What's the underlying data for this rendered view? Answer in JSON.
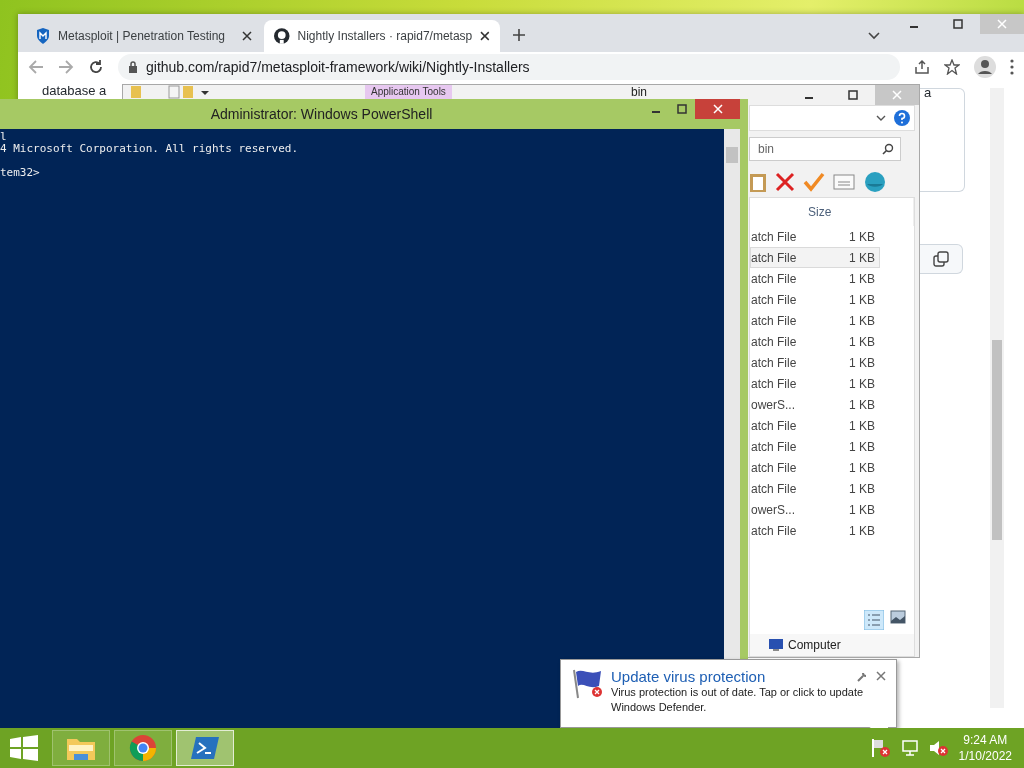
{
  "browser": {
    "tabs": [
      {
        "title": "Metasploit | Penetration Testing",
        "selected": false
      },
      {
        "title": "Nightly Installers · rapid7/metasp",
        "selected": true
      }
    ],
    "url": "github.com/rapid7/metasploit-framework/wiki/Nightly-Installers",
    "page_texts": [
      "database a",
      "a"
    ]
  },
  "explorer": {
    "ribbon_tab": "Application Tools",
    "title": "bin",
    "search": {
      "placeholder": "bin"
    },
    "size_header": "Size",
    "nav_item": "Computer",
    "files": [
      {
        "type": "atch File",
        "size": "1 KB",
        "selected": false
      },
      {
        "type": "atch File",
        "size": "1 KB",
        "selected": true
      },
      {
        "type": "atch File",
        "size": "1 KB",
        "selected": false
      },
      {
        "type": "atch File",
        "size": "1 KB",
        "selected": false
      },
      {
        "type": "atch File",
        "size": "1 KB",
        "selected": false
      },
      {
        "type": "atch File",
        "size": "1 KB",
        "selected": false
      },
      {
        "type": "atch File",
        "size": "1 KB",
        "selected": false
      },
      {
        "type": "atch File",
        "size": "1 KB",
        "selected": false
      },
      {
        "type": "owerS...",
        "size": "1 KB",
        "selected": false
      },
      {
        "type": "atch File",
        "size": "1 KB",
        "selected": false
      },
      {
        "type": "atch File",
        "size": "1 KB",
        "selected": false
      },
      {
        "type": "atch File",
        "size": "1 KB",
        "selected": false
      },
      {
        "type": "atch File",
        "size": "1 KB",
        "selected": false
      },
      {
        "type": "owerS...",
        "size": "1 KB",
        "selected": false
      },
      {
        "type": "atch File",
        "size": "1 KB",
        "selected": false
      }
    ]
  },
  "powershell": {
    "title": "Administrator: Windows PowerShell",
    "lines": [
      {
        "text": "l",
        "kind": "output"
      },
      {
        "text": "4 Microsoft Corporation. All rights reserved.",
        "kind": "output"
      },
      {
        "text": "tem32>",
        "kind": "prompt"
      }
    ]
  },
  "notification": {
    "title": "Update virus protection",
    "body": "Virus protection is out of date. Tap or click to update Windows Defender."
  },
  "taskbar": {
    "apps": [
      {
        "kind": "explorer",
        "selected": false
      },
      {
        "kind": "chrome",
        "selected": false
      },
      {
        "kind": "powershell",
        "selected": true
      }
    ],
    "time": "9:24 AM",
    "date": "1/10/2022"
  }
}
